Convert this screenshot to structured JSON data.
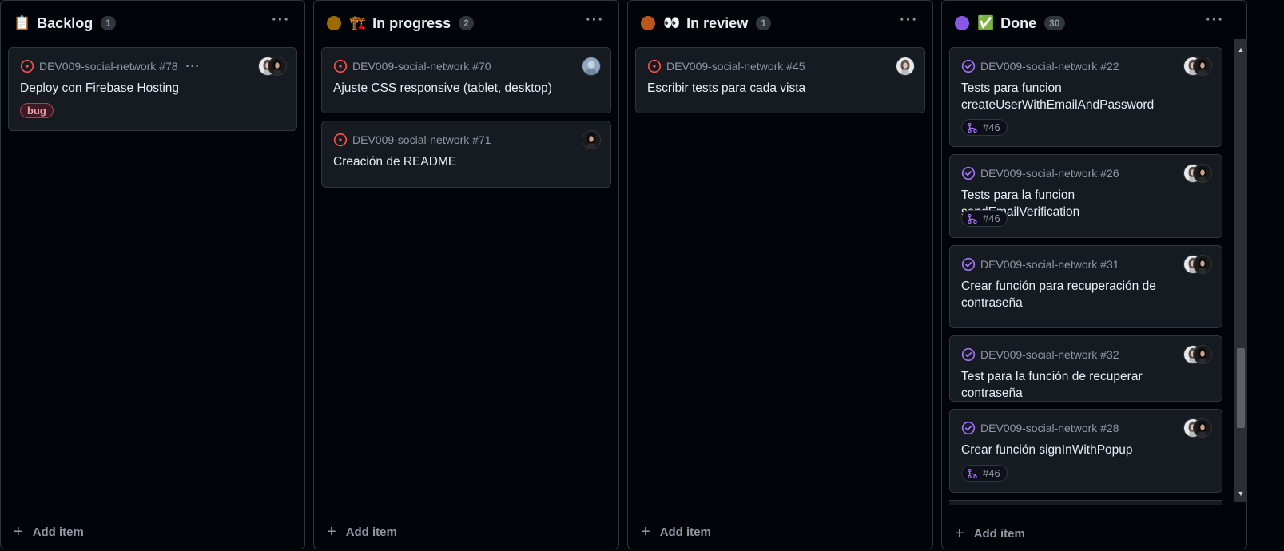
{
  "columns": [
    {
      "title": "Backlog",
      "emoji": "📋",
      "count": "1",
      "add_item": "Add item",
      "cards": [
        {
          "repo": "DEV009-social-network #78",
          "title": "Deploy con Firebase Hosting",
          "label": "bug"
        }
      ]
    },
    {
      "title": "In progress",
      "emoji": "🏗️",
      "count": "2",
      "status_color": "#9e6a03",
      "add_item": "Add item",
      "cards": [
        {
          "repo": "DEV009-social-network #70",
          "title": "Ajuste CSS responsive (tablet, desktop)"
        },
        {
          "repo": "DEV009-social-network #71",
          "title": "Creación de README"
        }
      ]
    },
    {
      "title": "In review",
      "emoji": "👀",
      "count": "1",
      "status_color": "#bd561d",
      "add_item": "Add item",
      "cards": [
        {
          "repo": "DEV009-social-network #45",
          "title": "Escribir tests para cada vista"
        }
      ]
    },
    {
      "title": "Done",
      "emoji": "✅",
      "count": "30",
      "status_color": "#8957e5",
      "add_item": "Add item",
      "cards": [
        {
          "repo": "DEV009-social-network #22",
          "title": "Tests para funcion createUserWithEmailAndPassword",
          "pr": "#46"
        },
        {
          "repo": "DEV009-social-network #26",
          "title": "Tests para la funcion sendEmailVerification",
          "pr": "#46"
        },
        {
          "repo": "DEV009-social-network #31",
          "title": "Crear función para recuperación de contraseña"
        },
        {
          "repo": "DEV009-social-network #32",
          "title": "Test para la función de recuperar contraseña"
        },
        {
          "repo": "DEV009-social-network #28",
          "title": "Crear función signInWithPopup",
          "pr": "#46"
        }
      ]
    }
  ],
  "colors": {
    "open_issue": "#f85149",
    "closed_issue": "#a371f7",
    "background": "#010409",
    "card": "#161b22",
    "border": "#30363d"
  },
  "icons": {
    "open_issue": "issue-opened-icon",
    "closed_issue": "issue-closed-icon",
    "pull_request": "git-pull-request-icon",
    "menu": "kebab-horizontal-icon",
    "add": "plus-icon"
  }
}
